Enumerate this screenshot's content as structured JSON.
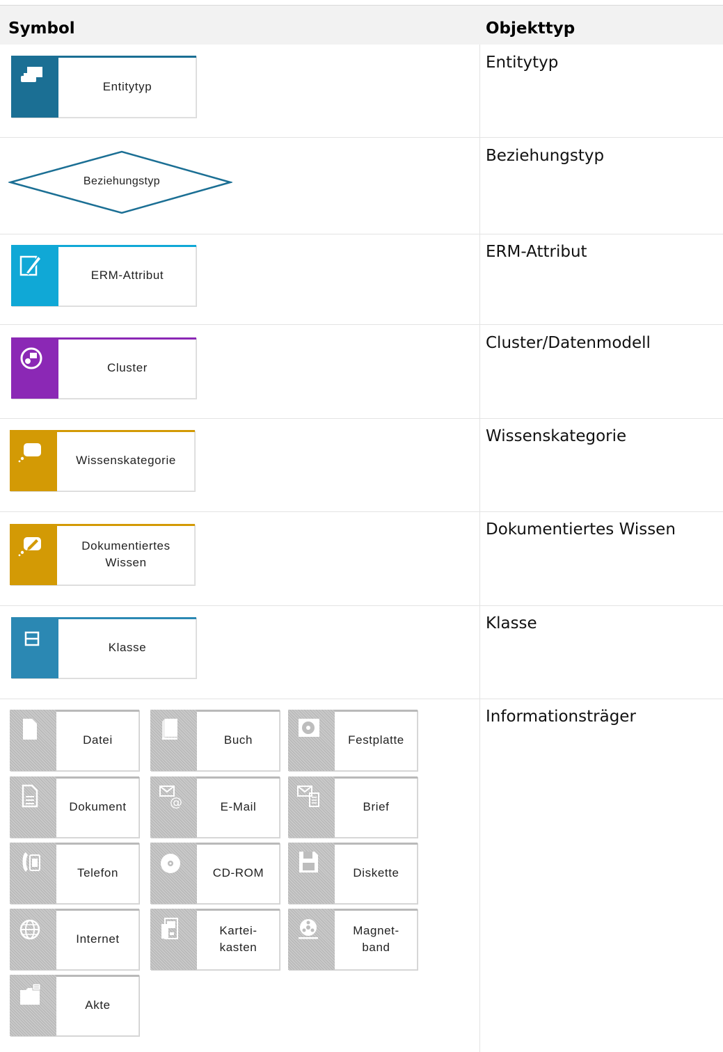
{
  "table": {
    "header": {
      "symbol": "Symbol",
      "objekttyp": "Objekttyp"
    },
    "rows": [
      {
        "symbol_label": "Entitytyp",
        "type": "Entitytyp"
      },
      {
        "symbol_label": "Beziehungstyp",
        "type": "Beziehungstyp"
      },
      {
        "symbol_label": "ERM-Attribut",
        "type": "ERM-Attribut"
      },
      {
        "symbol_label": "Cluster",
        "type": "Cluster/Datenmodell"
      },
      {
        "symbol_label": "Wissenskategorie",
        "type": "Wissenskategorie"
      },
      {
        "symbol_label": "Dokumentiertes Wissen",
        "type": "Dokumentiertes Wissen"
      },
      {
        "symbol_label": "Klasse",
        "type": "Klasse"
      },
      {
        "type": "Informationsträger"
      }
    ],
    "info_carriers": [
      {
        "label": "Datei",
        "icon": "file-icon"
      },
      {
        "label": "Buch",
        "icon": "book-icon"
      },
      {
        "label": "Festplatte",
        "icon": "hard-disk-icon"
      },
      {
        "label": "Dokument",
        "icon": "document-icon"
      },
      {
        "label": "E-Mail",
        "icon": "email-icon"
      },
      {
        "label": "Brief",
        "icon": "letter-icon"
      },
      {
        "label": "Telefon",
        "icon": "telephone-icon"
      },
      {
        "label": "CD-ROM",
        "icon": "cd-rom-icon"
      },
      {
        "label": "Diskette",
        "icon": "diskette-icon"
      },
      {
        "label": "Internet",
        "icon": "globe-icon"
      },
      {
        "label": "Kartei-\nkasten",
        "icon": "card-index-icon"
      },
      {
        "label": "Magnet-\nband",
        "icon": "magnetic-tape-icon"
      },
      {
        "label": "Akte",
        "icon": "folder-icon"
      }
    ]
  },
  "colors": {
    "entity": "#1b6f94",
    "attribute": "#10a8d6",
    "cluster": "#8b28b5",
    "knowledge": "#d39a05",
    "class": "#2b88b3",
    "carrier": "#bdbdbd"
  }
}
